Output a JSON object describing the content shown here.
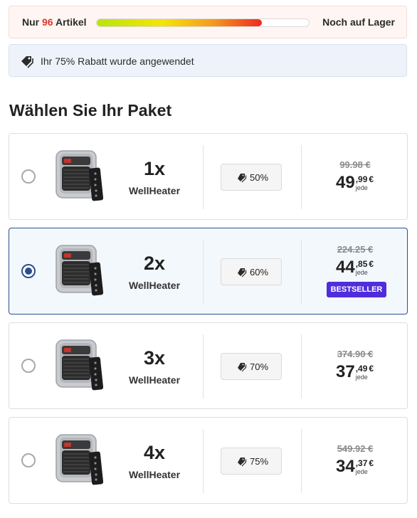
{
  "stock": {
    "prefix": "Nur",
    "count": "96",
    "suffix": "Artikel",
    "right_label": "Noch auf Lager",
    "level_percent": 78
  },
  "discount_banner": {
    "text": "Ihr 75% Rabatt wurde angewendet",
    "icon": "tag-icon"
  },
  "heading": "Wählen Sie Ihr Paket",
  "packages": [
    {
      "qty": "1x",
      "name": "WellHeater",
      "discount": "50%",
      "old_price": "99.98 €",
      "price_int": "49",
      "price_dec": ",99",
      "currency": "€",
      "per": "jede",
      "selected": false,
      "bestseller": ""
    },
    {
      "qty": "2x",
      "name": "WellHeater",
      "discount": "60%",
      "old_price": "224.25 €",
      "price_int": "44",
      "price_dec": ",85",
      "currency": "€",
      "per": "jede",
      "selected": true,
      "bestseller": "BESTSELLER"
    },
    {
      "qty": "3x",
      "name": "WellHeater",
      "discount": "70%",
      "old_price": "374.90 €",
      "price_int": "37",
      "price_dec": ",49",
      "currency": "€",
      "per": "jede",
      "selected": false,
      "bestseller": ""
    },
    {
      "qty": "4x",
      "name": "WellHeater",
      "discount": "75%",
      "old_price": "549.92 €",
      "price_int": "34",
      "price_dec": ",37",
      "currency": "€",
      "per": "jede",
      "selected": false,
      "bestseller": ""
    }
  ],
  "colors": {
    "accent_selected": "#2c4f8c",
    "bestseller_bg": "#4f2ddc",
    "stock_count": "#e0362c"
  }
}
